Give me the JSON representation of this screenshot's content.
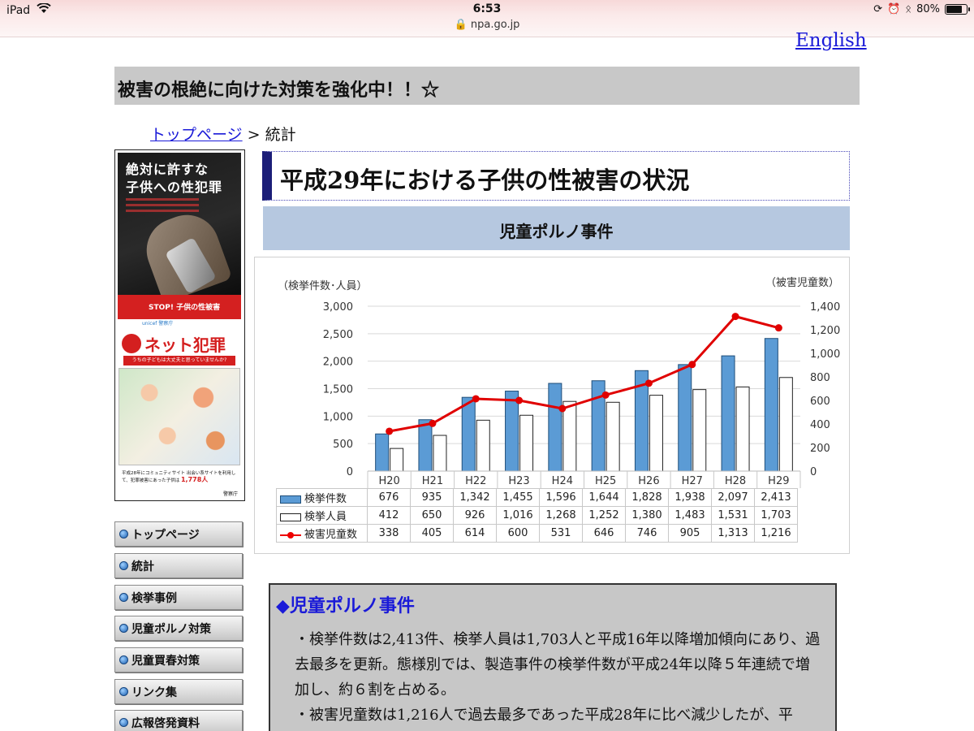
{
  "status": {
    "device": "iPad",
    "time": "6:53",
    "url": "npa.go.jp",
    "battery": "80%",
    "battery_fraction": 0.8
  },
  "header": {
    "english": "English",
    "banner": "被害の根絶に向けた対策を強化中！！☆"
  },
  "breadcrumb": {
    "top": "トップページ",
    "sep": " > ",
    "current": "統計"
  },
  "poster": {
    "title_line1": "絶対に許すな",
    "title_line2": "子供への性犯罪",
    "stop_text": "STOP! 子供の性被害",
    "logos": "unicef  警察庁",
    "net_title": "ネット犯罪",
    "net_sub": "うちの子どもは大丈夫と思っていませんか?",
    "bottom_text": "平成28年にコミュニティサイト 出会い系サイトを利用して、犯罪被害にあった子供は",
    "bottom_count": "1,778人",
    "agency": "警察庁"
  },
  "nav": {
    "items": [
      {
        "label": "トップページ"
      },
      {
        "label": "統計"
      },
      {
        "label": "検挙事例"
      },
      {
        "label": "児童ポルノ対策"
      },
      {
        "label": "児童買春対策"
      },
      {
        "label": "リンク集"
      },
      {
        "label": "広報啓発資料"
      }
    ]
  },
  "main": {
    "title": "平成29年における子供の性被害の状況",
    "section": "児童ポルノ事件"
  },
  "chart_data": {
    "type": "bar",
    "categories": [
      "H20",
      "H21",
      "H22",
      "H23",
      "H24",
      "H25",
      "H26",
      "H27",
      "H28",
      "H29"
    ],
    "left_axis_label": "（検挙件数･人員）",
    "right_axis_label": "（被害児童数）",
    "left_ylim": [
      0,
      3000
    ],
    "left_ticks": [
      "0",
      "500",
      "1,000",
      "1,500",
      "2,000",
      "2,500",
      "3,000"
    ],
    "right_ylim": [
      0,
      1400
    ],
    "right_ticks": [
      "0",
      "200",
      "400",
      "600",
      "800",
      "1,000",
      "1,200",
      "1,400"
    ],
    "grid": true,
    "series": [
      {
        "name": "検挙件数",
        "type": "bar",
        "axis": "left",
        "color": "#5b9bd5",
        "values": [
          676,
          935,
          1342,
          1455,
          1596,
          1644,
          1828,
          1938,
          2097,
          2413
        ],
        "labels": [
          "676",
          "935",
          "1,342",
          "1,455",
          "1,596",
          "1,644",
          "1,828",
          "1,938",
          "2,097",
          "2,413"
        ]
      },
      {
        "name": "検挙人員",
        "type": "bar",
        "axis": "left",
        "color": "#ffffff",
        "values": [
          412,
          650,
          926,
          1016,
          1268,
          1252,
          1380,
          1483,
          1531,
          1703
        ],
        "labels": [
          "412",
          "650",
          "926",
          "1,016",
          "1,268",
          "1,252",
          "1,380",
          "1,483",
          "1,531",
          "1,703"
        ]
      },
      {
        "name": "被害児童数",
        "type": "line",
        "axis": "right",
        "color": "#e00000",
        "values": [
          338,
          405,
          614,
          600,
          531,
          646,
          746,
          905,
          1313,
          1216
        ],
        "labels": [
          "338",
          "405",
          "614",
          "600",
          "531",
          "646",
          "746",
          "905",
          "1,313",
          "1,216"
        ]
      }
    ]
  },
  "summary": {
    "heading": "◆児童ポルノ事件",
    "para1": "・検挙件数は2,413件、検挙人員は1,703人と平成16年以降増加傾向にあり、過去最多を更新。態様別では、製造事件の検挙件数が平成24年以降５年連続で増加し、約６割を占める。",
    "para2": "・被害児童数は1,216人で過去最多であった平成28年に比べ減少したが、平"
  }
}
